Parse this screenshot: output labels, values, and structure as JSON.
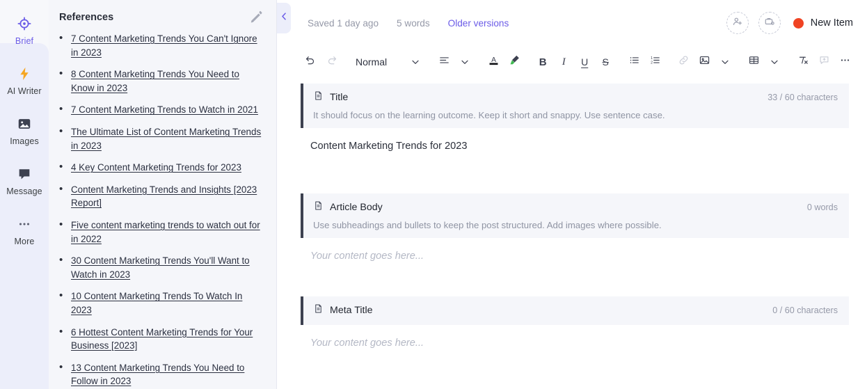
{
  "rail": {
    "items": [
      {
        "label": "Brief",
        "icon": "target-icon",
        "active": true
      },
      {
        "label": "AI Writer",
        "icon": "lightning-bolt-icon",
        "active": false
      },
      {
        "label": "Images",
        "icon": "image-icon",
        "active": false
      },
      {
        "label": "Message",
        "icon": "chat-bubble-icon",
        "active": false
      },
      {
        "label": "More",
        "icon": "ellipsis-icon",
        "active": false
      }
    ],
    "active_color": "#6b5ce7"
  },
  "references": {
    "title": "References",
    "edit_icon": "pencil-icon",
    "items": [
      "7 Content Marketing Trends You Can't Ignore in 2023",
      "8 Content Marketing Trends You Need to Know in 2023",
      "7 Content Marketing Trends to Watch in 2021",
      "The Ultimate List of Content Marketing Trends in 2023",
      "4 Key Content Marketing Trends for 2023",
      "Content Marketing Trends and Insights [2023 Report]",
      "Five content marketing trends to watch out for in 2022",
      "30 Content Marketing Trends You'll Want to Watch in 2023",
      "10 Content Marketing Trends To Watch In 2023",
      "6 Hottest Content Marketing Trends for Your Business [2023]",
      "13 Content Marketing Trends You Need to Follow in 2023"
    ]
  },
  "collapse": {
    "icon": "chevron-left-icon"
  },
  "topbar": {
    "saved_status": "Saved 1 day ago",
    "word_count": "5 words",
    "older_versions": "Older versions",
    "invite_icon": "add-person-icon",
    "brief_icon": "add-briefcase-icon",
    "new_item_label": "New Item",
    "new_item_dot_color": "#f04323",
    "link_color": "#6b5ce7"
  },
  "toolbar": {
    "undo": "undo-icon",
    "redo": "redo-icon",
    "style_value": "Normal",
    "style_chevron": "chevron-down-icon",
    "align": "align-left-icon",
    "align_chevron": "chevron-down-icon",
    "text_color": "text-color-icon",
    "highlight": "highlighter-icon",
    "bold": "B",
    "italic": "I",
    "underline": "U",
    "strikethrough": "S",
    "bullet_list": "bullet-list-icon",
    "numbered_list": "numbered-list-icon",
    "link": "link-icon",
    "image": "image-icon",
    "image_chevron": "chevron-down-icon",
    "table": "table-icon",
    "table_chevron": "chevron-down-icon",
    "clear_format": "clear-format-icon",
    "comment": "add-comment-icon",
    "more": "more-options-icon"
  },
  "sections": [
    {
      "icon": "document-icon",
      "name": "Title",
      "count": "33 / 60 characters",
      "hint": "It should focus on the learning outcome. Keep it short and snappy. Use sentence case.",
      "value": "Content Marketing Trends for 2023",
      "placeholder": ""
    },
    {
      "icon": "document-icon",
      "name": "Article Body",
      "count": "0 words",
      "hint": "Use subheadings and bullets to keep the post structured. Add images where possible.",
      "value": "",
      "placeholder": "Your content goes here..."
    },
    {
      "icon": "document-icon",
      "name": "Meta Title",
      "count": "0 / 60 characters",
      "hint": "",
      "value": "",
      "placeholder": "Your content goes here..."
    }
  ]
}
